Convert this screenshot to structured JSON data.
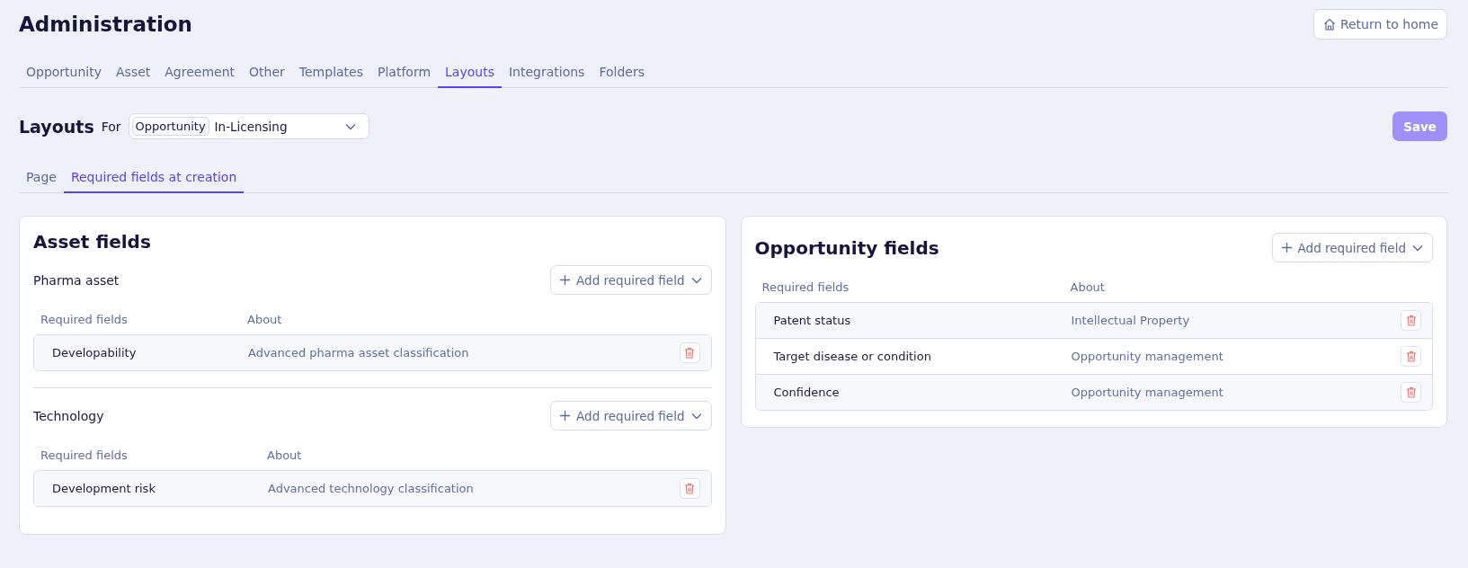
{
  "header": {
    "title": "Administration",
    "home_button": "Return to home"
  },
  "tabs": [
    {
      "label": "Opportunity",
      "selected": false
    },
    {
      "label": "Asset",
      "selected": false
    },
    {
      "label": "Agreement",
      "selected": false
    },
    {
      "label": "Other",
      "selected": false
    },
    {
      "label": "Templates",
      "selected": false
    },
    {
      "label": "Platform",
      "selected": false
    },
    {
      "label": "Layouts",
      "selected": true
    },
    {
      "label": "Integrations",
      "selected": false
    },
    {
      "label": "Folders",
      "selected": false
    }
  ],
  "layouts": {
    "title": "Layouts",
    "for_label": "For",
    "object_tag": "Opportunity",
    "value": "In-Licensing",
    "save_button": {
      "label": "Save",
      "disabled": true
    }
  },
  "subtabs": [
    {
      "label": "Page",
      "selected": false
    },
    {
      "label": "Required fields at creation",
      "selected": true
    }
  ],
  "asset_card": {
    "title": "Asset fields",
    "groups": [
      {
        "name": "Pharma asset",
        "add_button": "Add required field",
        "columns": [
          "Required fields",
          "About"
        ],
        "rows": [
          {
            "field": "Developability",
            "about": "Advanced pharma asset classification"
          }
        ]
      },
      {
        "name": "Technology",
        "add_button": "Add required field",
        "columns": [
          "Required fields",
          "About"
        ],
        "rows": [
          {
            "field": "Development risk",
            "about": "Advanced technology classification"
          }
        ]
      }
    ]
  },
  "opportunity_card": {
    "title": "Opportunity fields",
    "add_button": "Add required field",
    "columns": [
      "Required fields",
      "About"
    ],
    "rows": [
      {
        "field": "Patent status",
        "about": "Intellectual Property"
      },
      {
        "field": "Target disease or condition",
        "about": "Opportunity management"
      },
      {
        "field": "Confidence",
        "about": "Opportunity management"
      }
    ]
  }
}
